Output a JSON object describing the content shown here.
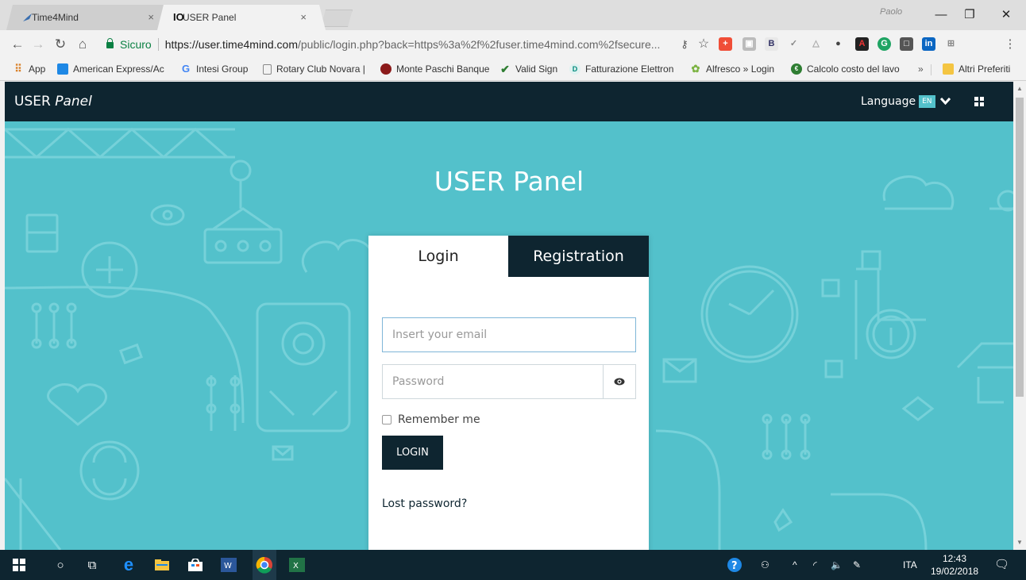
{
  "browser": {
    "tabs": [
      {
        "title": "Time4Mind",
        "active": false
      },
      {
        "title": "USER Panel",
        "active": true
      }
    ],
    "profile_name": "Paolo",
    "omnibox": {
      "secure_label": "Sicuro",
      "url_host": "https://user.time4mind.com",
      "url_rest": "/public/login.php?back=https%3a%2f%2fuser.time4mind.com%2fsecure..."
    },
    "bookmarks": [
      {
        "label": "App",
        "icon": "apps-icon"
      },
      {
        "label": "American Express/Ac",
        "icon": "amex-icon"
      },
      {
        "label": "Intesi Group",
        "icon": "google-icon"
      },
      {
        "label": "Rotary Club Novara |",
        "icon": "page-icon"
      },
      {
        "label": "Monte Paschi Banque",
        "icon": "bank-icon"
      },
      {
        "label": "Valid Sign",
        "icon": "check-icon"
      },
      {
        "label": "Fatturazione Elettron",
        "icon": "invoice-icon"
      },
      {
        "label": "Alfresco » Login",
        "icon": "alfresco-icon"
      },
      {
        "label": "Calcolo costo del lavo",
        "icon": "calc-icon"
      }
    ],
    "bookmarks_overflow": "»",
    "other_bookmarks": "Altri Preferiti"
  },
  "site": {
    "brand_main": "USER",
    "brand_italic": "Panel",
    "language_label": "Language",
    "language_code": "EN",
    "heading": "USER Panel",
    "tab_login": "Login",
    "tab_registration": "Registration",
    "email_placeholder": "Insert your email",
    "password_placeholder": "Password",
    "remember_me": "Remember me",
    "login_button": "LOGIN",
    "lost_password": "Lost password?"
  },
  "taskbar": {
    "lang": "ITA",
    "time": "12:43",
    "date": "19/02/2018"
  },
  "colors": {
    "accent": "#53c1cb",
    "dark": "#0e2530"
  }
}
